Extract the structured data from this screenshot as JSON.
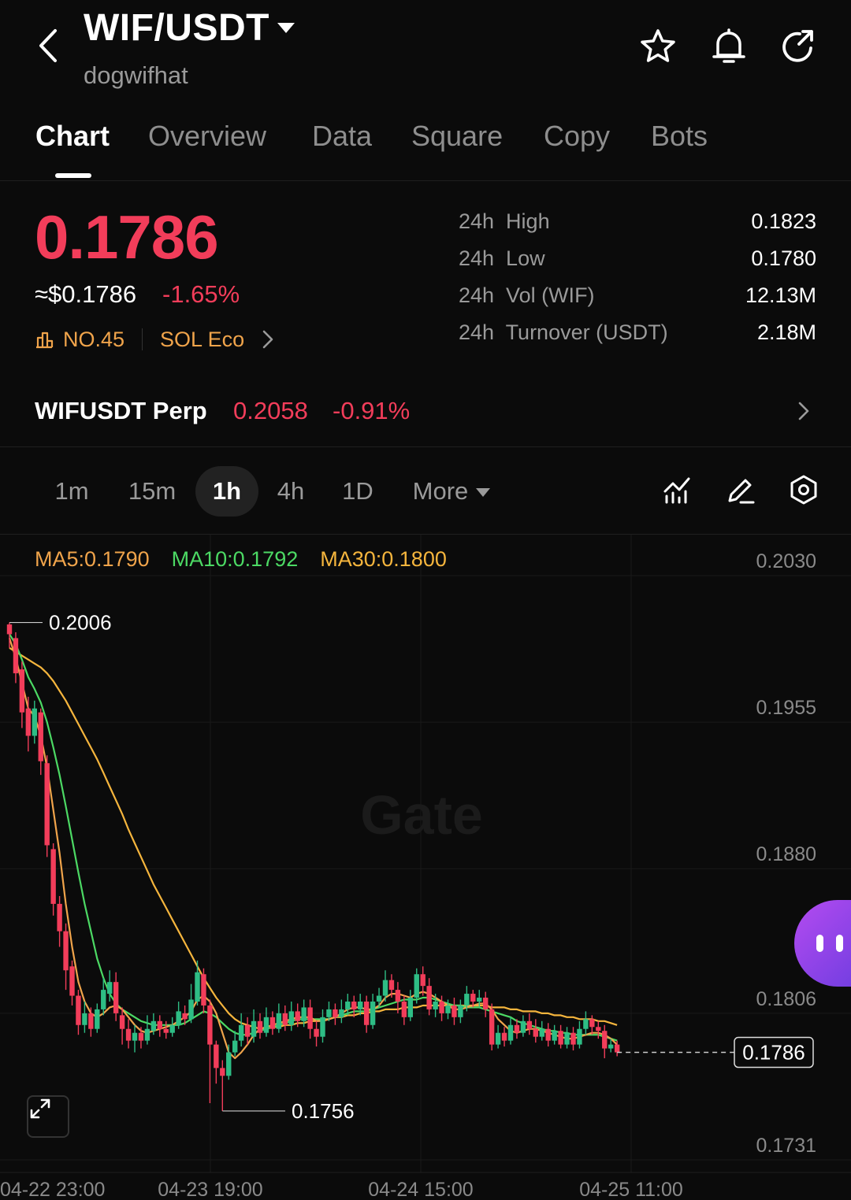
{
  "header": {
    "pair": "WIF/USDT",
    "name": "dogwifhat"
  },
  "tabs": [
    "Chart",
    "Overview",
    "Data",
    "Square",
    "Copy",
    "Bots"
  ],
  "active_tab": "Chart",
  "price": {
    "last": "0.1786",
    "usd": "≈$0.1786",
    "change": "-1.65%",
    "rank": "NO.45",
    "ecosystem": "SOL Eco"
  },
  "stats": [
    {
      "label": "24h  High",
      "value": "0.1823"
    },
    {
      "label": "24h  Low",
      "value": "0.1780"
    },
    {
      "label": "24h  Vol (WIF)",
      "value": "12.13M"
    },
    {
      "label": "24h  Turnover (USDT)",
      "value": "2.18M"
    }
  ],
  "perp": {
    "name": "WIFUSDT Perp",
    "price": "0.2058",
    "change": "-0.91%"
  },
  "intervals": [
    "1m",
    "15m",
    "1h",
    "4h",
    "1D"
  ],
  "active_interval": "1h",
  "more_label": "More",
  "colors": {
    "up": "#2ebd85",
    "down": "#f23d5a",
    "accent": "#f0a44b",
    "ma5": "#f0a44b",
    "ma10": "#4cd964",
    "ma30": "#f5b53d"
  },
  "chart_data": {
    "type": "candlestick",
    "watermark": "Gate",
    "ma_legend": {
      "ma5": "MA5:0.1790",
      "ma10": "MA10:0.1792",
      "ma30": "MA30:0.1800"
    },
    "y_ticks": [
      "0.2030",
      "0.1955",
      "0.1880",
      "0.1806",
      "0.1731"
    ],
    "x_ticks": [
      "04-22 23:00",
      "04-23 19:00",
      "04-24 15:00",
      "04-25 11:00"
    ],
    "ylim": [
      0.1731,
      0.203
    ],
    "high_marker": "0.2006",
    "low_marker": "0.1756",
    "last_price_label": "0.1786",
    "candles": [
      [
        0.2005,
        0.2,
        0.2006,
        0.1993
      ],
      [
        0.1998,
        0.198,
        0.2001,
        0.1975
      ],
      [
        0.1982,
        0.196,
        0.1986,
        0.1952
      ],
      [
        0.1962,
        0.1948,
        0.1968,
        0.194
      ],
      [
        0.1948,
        0.1962,
        0.1966,
        0.1944
      ],
      [
        0.196,
        0.1935,
        0.1962,
        0.1928
      ],
      [
        0.1934,
        0.1892,
        0.1938,
        0.1886
      ],
      [
        0.189,
        0.1862,
        0.1893,
        0.1856
      ],
      [
        0.1862,
        0.1848,
        0.1866,
        0.184
      ],
      [
        0.1848,
        0.1828,
        0.1852,
        0.1818
      ],
      [
        0.183,
        0.1815,
        0.1833,
        0.181
      ],
      [
        0.1815,
        0.18,
        0.1818,
        0.1795
      ],
      [
        0.18,
        0.1806,
        0.1812,
        0.1796
      ],
      [
        0.1806,
        0.1798,
        0.1809,
        0.1794
      ],
      [
        0.1798,
        0.1808,
        0.1811,
        0.1796
      ],
      [
        0.1808,
        0.1818,
        0.1824,
        0.1805
      ],
      [
        0.1816,
        0.1822,
        0.1828,
        0.1812
      ],
      [
        0.1822,
        0.1806,
        0.1827,
        0.1802
      ],
      [
        0.1805,
        0.1798,
        0.1809,
        0.179
      ],
      [
        0.1798,
        0.1792,
        0.1803,
        0.1788
      ],
      [
        0.1792,
        0.1796,
        0.18,
        0.1786
      ],
      [
        0.1796,
        0.1792,
        0.1799,
        0.1788
      ],
      [
        0.1792,
        0.1798,
        0.1805,
        0.179
      ],
      [
        0.1797,
        0.1802,
        0.1806,
        0.1795
      ],
      [
        0.1802,
        0.1798,
        0.1805,
        0.1794
      ],
      [
        0.1798,
        0.1796,
        0.1802,
        0.1793
      ],
      [
        0.1796,
        0.18,
        0.1804,
        0.1794
      ],
      [
        0.18,
        0.1807,
        0.1812,
        0.1798
      ],
      [
        0.1806,
        0.1803,
        0.181,
        0.18
      ],
      [
        0.1803,
        0.1813,
        0.1821,
        0.1801
      ],
      [
        0.1812,
        0.1827,
        0.1833,
        0.181
      ],
      [
        0.1826,
        0.181,
        0.1829,
        0.1806
      ],
      [
        0.181,
        0.179,
        0.1813,
        0.176
      ],
      [
        0.179,
        0.1778,
        0.1792,
        0.177
      ],
      [
        0.1778,
        0.1774,
        0.1782,
        0.1756
      ],
      [
        0.1774,
        0.1786,
        0.179,
        0.1772
      ],
      [
        0.1786,
        0.1792,
        0.1797,
        0.1784
      ],
      [
        0.1792,
        0.18,
        0.1806,
        0.1789
      ],
      [
        0.18,
        0.1794,
        0.1804,
        0.179
      ],
      [
        0.1794,
        0.1802,
        0.1808,
        0.1791
      ],
      [
        0.1802,
        0.1796,
        0.1806,
        0.1793
      ],
      [
        0.1796,
        0.1804,
        0.1809,
        0.1794
      ],
      [
        0.1804,
        0.1798,
        0.1807,
        0.1795
      ],
      [
        0.1798,
        0.1806,
        0.1811,
        0.1796
      ],
      [
        0.1806,
        0.18,
        0.181,
        0.1797
      ],
      [
        0.18,
        0.1807,
        0.1812,
        0.1797
      ],
      [
        0.1807,
        0.1802,
        0.1811,
        0.1799
      ],
      [
        0.1802,
        0.1809,
        0.1813,
        0.1799
      ],
      [
        0.1809,
        0.1798,
        0.1813,
        0.1793
      ],
      [
        0.1798,
        0.1794,
        0.1802,
        0.1789
      ],
      [
        0.1794,
        0.1804,
        0.1808,
        0.1791
      ],
      [
        0.1804,
        0.1808,
        0.1812,
        0.1802
      ],
      [
        0.1808,
        0.1804,
        0.1811,
        0.18
      ],
      [
        0.1804,
        0.1808,
        0.1813,
        0.1801
      ],
      [
        0.1808,
        0.1812,
        0.1816,
        0.1805
      ],
      [
        0.1812,
        0.1808,
        0.1815,
        0.1804
      ],
      [
        0.1808,
        0.1812,
        0.1816,
        0.1805
      ],
      [
        0.1812,
        0.18,
        0.1815,
        0.1796
      ],
      [
        0.18,
        0.1812,
        0.1816,
        0.1798
      ],
      [
        0.1812,
        0.1815,
        0.1819,
        0.1809
      ],
      [
        0.1815,
        0.1823,
        0.1828,
        0.1812
      ],
      [
        0.1823,
        0.1818,
        0.1826,
        0.1814
      ],
      [
        0.1818,
        0.1812,
        0.1822,
        0.1806
      ],
      [
        0.1812,
        0.1804,
        0.1815,
        0.18
      ],
      [
        0.1804,
        0.1814,
        0.1818,
        0.1802
      ],
      [
        0.1814,
        0.1826,
        0.1829,
        0.1811
      ],
      [
        0.1826,
        0.182,
        0.183,
        0.1815
      ],
      [
        0.182,
        0.1808,
        0.1824,
        0.1805
      ],
      [
        0.1808,
        0.1812,
        0.1816,
        0.1804
      ],
      [
        0.1812,
        0.1806,
        0.1815,
        0.1802
      ],
      [
        0.1806,
        0.181,
        0.1813,
        0.1803
      ],
      [
        0.181,
        0.1804,
        0.1814,
        0.18
      ],
      [
        0.1804,
        0.181,
        0.1813,
        0.1801
      ],
      [
        0.181,
        0.1816,
        0.182,
        0.1807
      ],
      [
        0.1816,
        0.1812,
        0.1818,
        0.1809
      ],
      [
        0.1812,
        0.1814,
        0.1818,
        0.1809
      ],
      [
        0.1814,
        0.1808,
        0.1817,
        0.1804
      ],
      [
        0.1808,
        0.179,
        0.1811,
        0.1787
      ],
      [
        0.179,
        0.1796,
        0.18,
        0.1788
      ],
      [
        0.1796,
        0.1792,
        0.1799,
        0.1789
      ],
      [
        0.1792,
        0.18,
        0.1804,
        0.179
      ],
      [
        0.18,
        0.1796,
        0.1803,
        0.1793
      ],
      [
        0.1796,
        0.1802,
        0.1805,
        0.1794
      ],
      [
        0.1802,
        0.1798,
        0.1806,
        0.1795
      ],
      [
        0.1798,
        0.1794,
        0.1803,
        0.1791
      ],
      [
        0.1794,
        0.1798,
        0.1802,
        0.1792
      ],
      [
        0.1798,
        0.1792,
        0.1801,
        0.1789
      ],
      [
        0.1792,
        0.1797,
        0.18,
        0.179
      ],
      [
        0.1797,
        0.179,
        0.18,
        0.1788
      ],
      [
        0.179,
        0.1796,
        0.1799,
        0.1788
      ],
      [
        0.1796,
        0.179,
        0.1799,
        0.1787
      ],
      [
        0.179,
        0.1798,
        0.1802,
        0.1788
      ],
      [
        0.1798,
        0.1803,
        0.1807,
        0.1795
      ],
      [
        0.1803,
        0.1799,
        0.1805,
        0.1795
      ],
      [
        0.1799,
        0.1797,
        0.1802,
        0.1793
      ],
      [
        0.1797,
        0.1788,
        0.18,
        0.1783
      ],
      [
        0.1788,
        0.179,
        0.1793,
        0.1786
      ],
      [
        0.179,
        0.1786,
        0.1792,
        0.1784
      ]
    ],
    "ma5": [
      0.1998,
      0.1988,
      0.1975,
      0.1962,
      0.1958,
      0.1948,
      0.1932,
      0.191,
      0.1888,
      0.1862,
      0.184,
      0.1822,
      0.1812,
      0.1806,
      0.1804,
      0.1806,
      0.1809,
      0.181,
      0.1808,
      0.1804,
      0.18,
      0.1797,
      0.1796,
      0.1797,
      0.1798,
      0.1799,
      0.18,
      0.1802,
      0.1804,
      0.1807,
      0.1813,
      0.1815,
      0.1812,
      0.1806,
      0.1796,
      0.1786,
      0.1783,
      0.1786,
      0.179,
      0.1795,
      0.1798,
      0.1799,
      0.18,
      0.1801,
      0.1802,
      0.1803,
      0.1804,
      0.1804,
      0.1804,
      0.1802,
      0.1802,
      0.1803,
      0.1804,
      0.1806,
      0.1808,
      0.1809,
      0.1809,
      0.1808,
      0.1808,
      0.181,
      0.1814,
      0.1816,
      0.1816,
      0.1815,
      0.1814,
      0.1816,
      0.1817,
      0.1816,
      0.1814,
      0.1812,
      0.181,
      0.1808,
      0.1808,
      0.1809,
      0.181,
      0.1811,
      0.1811,
      0.1808,
      0.1803,
      0.18,
      0.1797,
      0.1796,
      0.1797,
      0.1798,
      0.1798,
      0.1797,
      0.1796,
      0.1795,
      0.1794,
      0.1793,
      0.1793,
      0.1794,
      0.1795,
      0.1796,
      0.1796,
      0.1795,
      0.1793,
      0.179
    ],
    "ma10": [
      0.2,
      0.1995,
      0.1987,
      0.1978,
      0.1972,
      0.1965,
      0.1955,
      0.1942,
      0.1928,
      0.1912,
      0.1895,
      0.1878,
      0.1862,
      0.1848,
      0.1834,
      0.1824,
      0.1816,
      0.1811,
      0.1808,
      0.1806,
      0.1804,
      0.1802,
      0.1801,
      0.18,
      0.18,
      0.18,
      0.18,
      0.18,
      0.1801,
      0.1803,
      0.1805,
      0.1807,
      0.1806,
      0.1804,
      0.1801,
      0.1798,
      0.1796,
      0.1795,
      0.1795,
      0.1796,
      0.1797,
      0.1798,
      0.1799,
      0.18,
      0.1801,
      0.1802,
      0.1803,
      0.1803,
      0.1803,
      0.1803,
      0.1803,
      0.1803,
      0.1804,
      0.1805,
      0.1806,
      0.1807,
      0.1807,
      0.1807,
      0.1808,
      0.1809,
      0.181,
      0.1811,
      0.1812,
      0.1813,
      0.1813,
      0.1813,
      0.1814,
      0.1814,
      0.1813,
      0.1812,
      0.1811,
      0.181,
      0.181,
      0.1809,
      0.1809,
      0.1809,
      0.1808,
      0.1807,
      0.1806,
      0.1805,
      0.1804,
      0.1802,
      0.1801,
      0.18,
      0.1799,
      0.1798,
      0.1797,
      0.1797,
      0.1796,
      0.1796,
      0.1795,
      0.1795,
      0.1795,
      0.1795,
      0.1795,
      0.1794,
      0.1793,
      0.1792
    ],
    "ma30": [
      0.1993,
      0.1991,
      0.1989,
      0.1987,
      0.1985,
      0.1983,
      0.198,
      0.1976,
      0.1971,
      0.1966,
      0.196,
      0.1954,
      0.1948,
      0.1942,
      0.1936,
      0.1929,
      0.1922,
      0.1915,
      0.1908,
      0.19,
      0.1893,
      0.1886,
      0.1879,
      0.1872,
      0.1866,
      0.186,
      0.1854,
      0.1848,
      0.1842,
      0.1836,
      0.183,
      0.1824,
      0.1819,
      0.1814,
      0.181,
      0.1806,
      0.1803,
      0.1801,
      0.18,
      0.1799,
      0.1798,
      0.1798,
      0.1799,
      0.1799,
      0.18,
      0.18,
      0.1801,
      0.1801,
      0.1802,
      0.1802,
      0.1803,
      0.1803,
      0.1804,
      0.1804,
      0.1805,
      0.1805,
      0.1806,
      0.1806,
      0.1807,
      0.1807,
      0.1808,
      0.1808,
      0.1808,
      0.1809,
      0.1809,
      0.1809,
      0.181,
      0.181,
      0.181,
      0.181,
      0.181,
      0.181,
      0.181,
      0.181,
      0.181,
      0.181,
      0.181,
      0.1809,
      0.1809,
      0.1809,
      0.1808,
      0.1808,
      0.1807,
      0.1807,
      0.1807,
      0.1806,
      0.1806,
      0.1805,
      0.1805,
      0.1804,
      0.1804,
      0.1803,
      0.1803,
      0.1803,
      0.1802,
      0.1802,
      0.1801,
      0.18
    ]
  }
}
